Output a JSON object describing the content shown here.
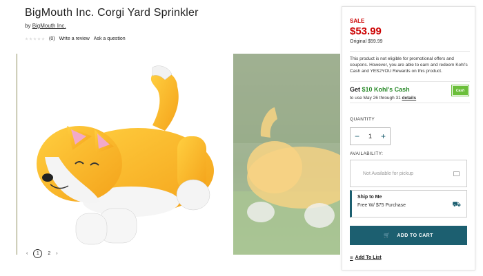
{
  "product": {
    "title": "BigMouth Inc. Corgi Yard Sprinkler",
    "by_prefix": "by",
    "brand": "BigMouth Inc.",
    "review_count": "(0)",
    "write_review": "Write a review",
    "ask_question": "Ask a question"
  },
  "gallery": {
    "prev_icon": "‹",
    "pages": [
      "1",
      "2"
    ],
    "next_icon": "›"
  },
  "pricing": {
    "sale_label": "SALE",
    "sale_price": "$53.99",
    "original": "Original $59.99",
    "promo_note": "This product is not eligible for promotional offers and coupons. However, you are able to earn and redeem Kohl's Cash and YES2YOU Rewards on this product.",
    "kc_prefix": "Get ",
    "kc_amount": "$10 Kohl's Cash",
    "kc_dates": "to use May 26 through 31 ",
    "kc_details": "details",
    "kc_badge": "Cash"
  },
  "quantity": {
    "label": "QUANTITY",
    "value": "1",
    "minus": "−",
    "plus": "+"
  },
  "availability": {
    "label": "AVAILABILITY:",
    "pickup": "Not Available for pickup",
    "ship_title": "Ship to Me",
    "ship_sub": "Free W/ $75 Purchase"
  },
  "actions": {
    "add_to_cart": "ADD TO CART",
    "add_to_list": "Add To List"
  },
  "colors": {
    "sale": "#cc0000",
    "accent": "#1c5f70",
    "kohls_green": "#2a8a2a"
  }
}
